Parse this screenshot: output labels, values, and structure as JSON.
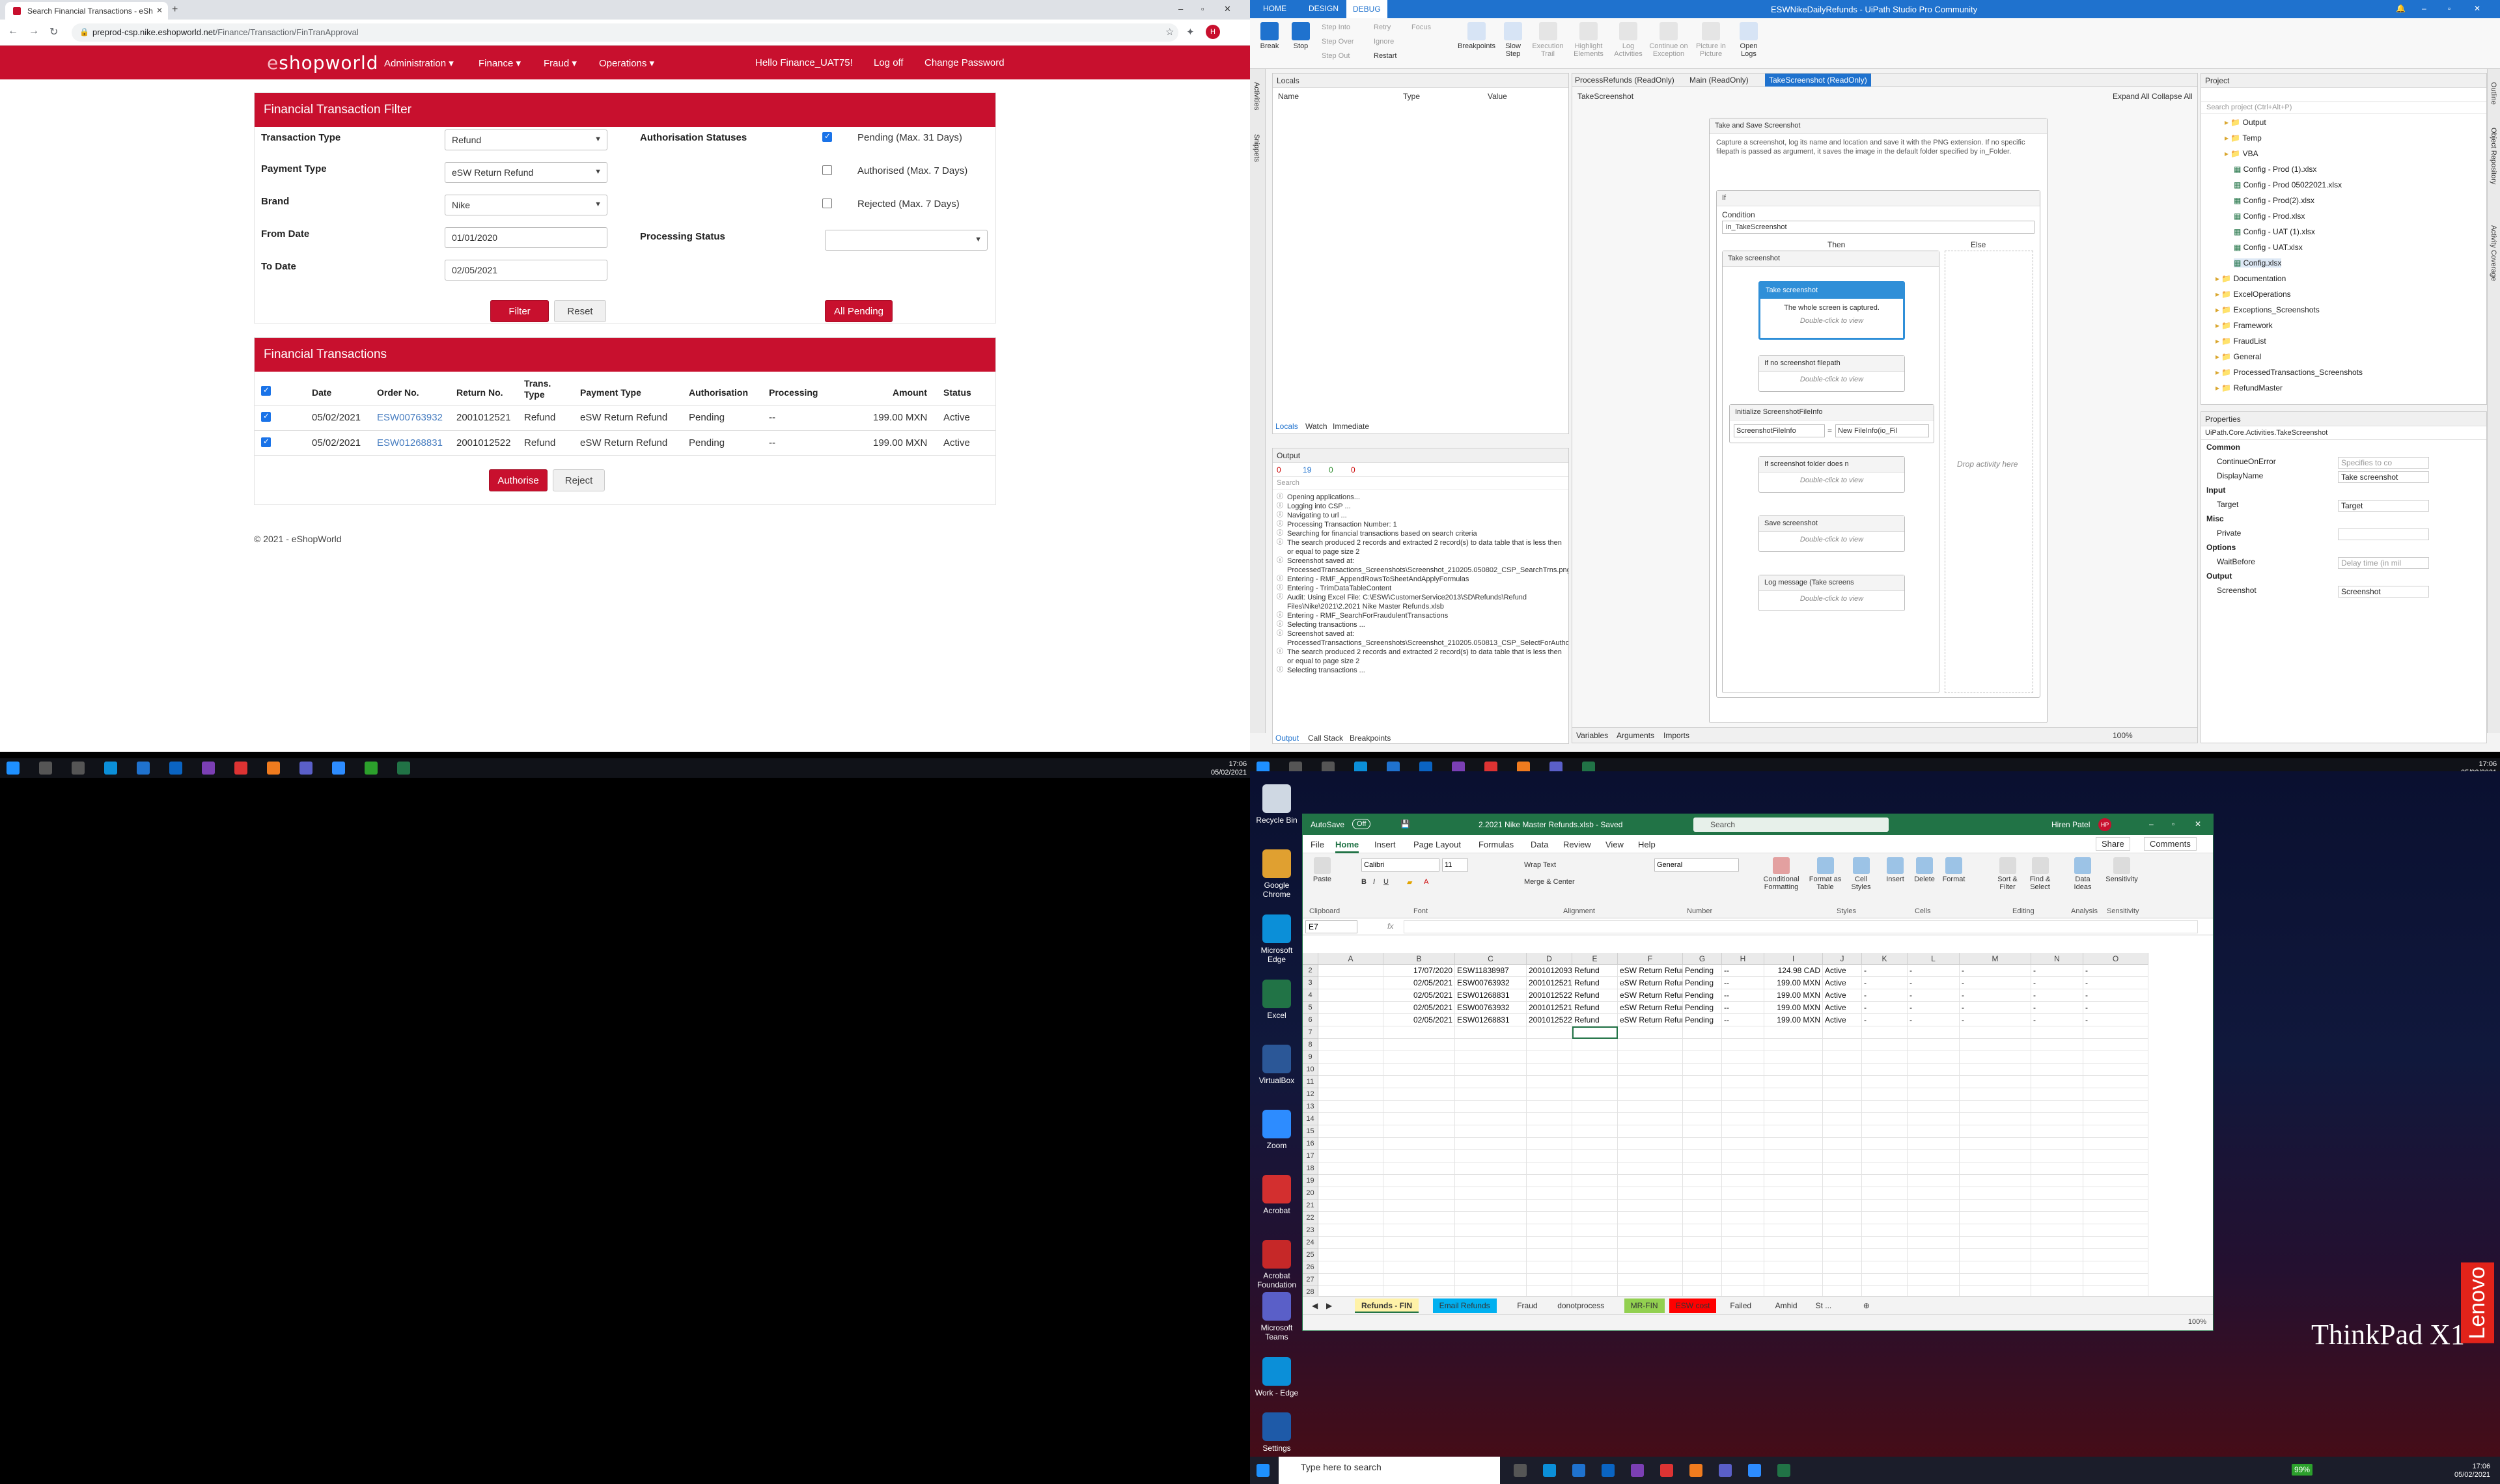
{
  "browser": {
    "tab_title": "Search Financial Transactions - eSh",
    "url_host": "preprod-csp.nike.eshopworld.net",
    "url_path": "/Finance/Transaction/FinTranApproval",
    "avatar_letter": "H",
    "site": {
      "logo_prefix": "e",
      "logo_main": "shopworld",
      "nav": [
        "Administration ▾",
        "Finance ▾",
        "Fraud ▾",
        "Operations ▾"
      ],
      "user_greeting": "Hello Finance_UAT75!",
      "logout": "Log off",
      "change_password": "Change Password",
      "accent": "#c8102e"
    },
    "filter": {
      "title": "Financial Transaction Filter",
      "transaction_type_label": "Transaction Type",
      "transaction_type_value": "Refund",
      "payment_type_label": "Payment Type",
      "payment_type_value": "eSW Return Refund",
      "brand_label": "Brand",
      "brand_value": "Nike",
      "from_date_label": "From Date",
      "from_date_value": "01/01/2020",
      "to_date_label": "To Date",
      "to_date_value": "02/05/2021",
      "auth_statuses_label": "Authorisation Statuses",
      "statuses": [
        {
          "label": "Pending (Max. 31 Days)",
          "checked": true
        },
        {
          "label": "Authorised (Max. 7 Days)",
          "checked": false
        },
        {
          "label": "Rejected (Max. 7 Days)",
          "checked": false
        }
      ],
      "processing_status_label": "Processing Status",
      "processing_status_value": "",
      "filter_button": "Filter",
      "reset_button": "Reset",
      "all_pending_button": "All Pending"
    },
    "transactions": {
      "title": "Financial Transactions",
      "columns": [
        "Date",
        "Order No.",
        "Return No.",
        "Trans. Type",
        "Payment Type",
        "Authorisation",
        "Processing",
        "Amount",
        "Status"
      ],
      "rows": [
        {
          "date": "05/02/2021",
          "order": "ESW00763932",
          "return": "2001012521",
          "type": "Refund",
          "payment": "eSW Return Refund",
          "auth": "Pending",
          "processing": "--",
          "amount": "199.00 MXN",
          "status": "Active"
        },
        {
          "date": "05/02/2021",
          "order": "ESW01268831",
          "return": "2001012522",
          "type": "Refund",
          "payment": "eSW Return Refund",
          "auth": "Pending",
          "processing": "--",
          "amount": "199.00 MXN",
          "status": "Active"
        }
      ],
      "authorise_button": "Authorise",
      "reject_button": "Reject"
    },
    "footer": "© 2021 - eShopWorld"
  },
  "uipath": {
    "title": "ESWNikeDailyRefunds - UiPath Studio Pro Community",
    "tabs": [
      "HOME",
      "DESIGN",
      "DEBUG"
    ],
    "ribbon": [
      "Break",
      "Stop",
      "Step Into",
      "Step Over",
      "Step Out",
      "Retry",
      "Ignore",
      "Restart",
      "Focus",
      "Breakpoints",
      "Slow Step",
      "Execution Trail",
      "Highlight Elements",
      "Log Activities",
      "Continue on Exception",
      "Picture in Picture",
      "Open Logs"
    ],
    "locals": {
      "title": "Locals",
      "cols": [
        "Name",
        "Type",
        "Value"
      ],
      "bottom_tabs": [
        "Locals",
        "Watch",
        "Immediate"
      ]
    },
    "doc_tabs": [
      "ProcessRefunds (ReadOnly)",
      "Main (ReadOnly)",
      "TakeScreenshot (ReadOnly)"
    ],
    "breadcrumb": "TakeScreenshot",
    "expand_all": "Expand All",
    "collapse_all": "Collapse All",
    "workflow": {
      "seq_title": "Take and Save Screenshot",
      "seq_desc": "Capture a screenshot, log its name and location and save it with the PNG extension. If no specific filepath is passed as argument, it saves the image in the default folder specified by in_Folder.",
      "if_title": "If",
      "condition_label": "Condition",
      "condition_value": "in_TakeScreenshot",
      "then": "Then",
      "else": "Else",
      "inner_seq": "Take screenshot",
      "act_take": "Take screenshot",
      "act_take_desc": "The whole screen is captured.",
      "dbl": "Double-click to view",
      "act_if_path": "If no screenshot filepath",
      "act_init": "Initialize ScreenshotFileInfo",
      "init_to": "ScreenshotFileInfo",
      "init_val": "New FileInfo(io_Fil",
      "act_if_folder": "If screenshot folder does n",
      "act_save": "Save screenshot",
      "act_log": "Log message (Take screens",
      "drop_here": "Drop activity here"
    },
    "output": {
      "title": "Output",
      "counts": [
        "0",
        "19",
        "0",
        "0"
      ],
      "search": "Search",
      "lines": [
        "Opening applications...",
        "Logging into CSP ...",
        "Navigating to url ...",
        "Processing Transaction Number: 1",
        "Searching for financial transactions based on search criteria",
        "The search produced 2 records and extracted 2 record(s) to data table that is less then or equal to page size 2",
        "Screenshot saved at: ProcessedTransactions_Screenshots\\Screenshot_210205.050802_CSP_SearchTrns.png",
        "Entering - RMF_AppendRowsToSheetAndApplyFormulas",
        "Entering - TrimDataTableContent",
        "Audit: Using Excel File: C:\\ESW\\CustomerService2013\\SD\\Refunds\\Refund Files\\Nike\\2021\\2.2021 Nike Master Refunds.xlsb",
        "Entering - RMF_SearchForFraudulentTransactions",
        "Selecting transactions ...",
        "Screenshot saved at: ProcessedTransactions_Screenshots\\Screenshot_210205.050813_CSP_SelectForAuthoriseTrns.png",
        "The search produced 2 records and extracted 2 record(s) to data table that is less then or equal to page size 2",
        "Selecting transactions ..."
      ],
      "bottom_tabs": [
        "Output",
        "Call Stack",
        "Breakpoints"
      ]
    },
    "designer_bottom": [
      "Variables",
      "Arguments",
      "Imports"
    ],
    "zoom": "100%",
    "project": {
      "title": "Project",
      "search": "Search project (Ctrl+Alt+P)",
      "items": [
        "Output",
        "Temp",
        "VBA",
        "Config - Prod (1).xlsx",
        "Config - Prod 05022021.xlsx",
        "Config - Prod(2).xlsx",
        "Config - Prod.xlsx",
        "Config - UAT (1).xlsx",
        "Config - UAT.xlsx",
        "Config.xlsx",
        "Documentation",
        "ExcelOperations",
        "Exceptions_Screenshots",
        "Framework",
        "FraudList",
        "General",
        "ProcessedTransactions_Screenshots",
        "RefundMaster"
      ]
    },
    "properties": {
      "title": "Properties",
      "type": "UiPath.Core.Activities.TakeScreenshot",
      "rows": [
        {
          "k": "Common",
          "v": "",
          "section": true
        },
        {
          "k": "ContinueOnError",
          "v": "Specifies to co"
        },
        {
          "k": "DisplayName",
          "v": "Take screenshot"
        },
        {
          "k": "Input",
          "v": "",
          "section": true
        },
        {
          "k": "Target",
          "v": "Target"
        },
        {
          "k": "Misc",
          "v": "",
          "section": true
        },
        {
          "k": "Private",
          "v": ""
        },
        {
          "k": "Options",
          "v": "",
          "section": true
        },
        {
          "k": "WaitBefore",
          "v": "Delay time (in mil"
        },
        {
          "k": "Output",
          "v": "",
          "section": true
        },
        {
          "k": "Screenshot",
          "v": "Screenshot"
        }
      ]
    },
    "side_left": [
      "Activities",
      "Snippets"
    ],
    "side_right": [
      "Outline",
      "Object Repository",
      "Activity Coverage"
    ]
  },
  "taskbar_top_left": {
    "time": "17:06",
    "date": "05/02/2021"
  },
  "taskbar_top_right": {
    "time": "17:06",
    "date": "05/02/2021"
  },
  "desktop": {
    "icons": [
      "Recycle Bin",
      "Google Chrome",
      "Microsoft Edge",
      "Excel",
      "VirtualBox",
      "Zoom",
      "Acrobat",
      "Acrobat Foundation",
      "Microsoft Teams",
      "Work - Edge",
      "Settings"
    ],
    "brand_model": "ThinkPad X1",
    "brand_vendor": "Lenovo"
  },
  "excel": {
    "autosave_label": "AutoSave",
    "autosave_state": "Off",
    "filename": "2.2021 Nike Master Refunds.xlsb - Saved",
    "search": "Search",
    "user": "Hiren Patel",
    "user_initials": "HP",
    "tabs": [
      "File",
      "Home",
      "Insert",
      "Page Layout",
      "Formulas",
      "Data",
      "Review",
      "View",
      "Help"
    ],
    "share": "Share",
    "comments": "Comments",
    "font_name": "Calibri",
    "font_size": "11",
    "wrap_text": "Wrap Text",
    "merge_center": "Merge & Center",
    "number_format": "General",
    "groups": [
      "Clipboard",
      "Font",
      "Alignment",
      "Number",
      "Styles",
      "Cells",
      "Editing",
      "Analysis",
      "Sensitivity"
    ],
    "ribbon_btns": [
      "Paste",
      "Conditional Formatting",
      "Format as Table",
      "Cell Styles",
      "Insert",
      "Delete",
      "Format",
      "Sort & Filter",
      "Find & Select",
      "Data Ideas",
      "Sensitivity"
    ],
    "name_box": "E7",
    "columns": [
      "A",
      "B",
      "C",
      "D",
      "E",
      "F",
      "G",
      "H",
      "I",
      "J",
      "K",
      "L",
      "M",
      "N",
      "O"
    ],
    "rows": [
      [
        "",
        "17/07/2020",
        "ESW11838987",
        "2001012093",
        "Refund",
        "eSW Return Refund",
        "Pending",
        "--",
        "124.98 CAD",
        "Active",
        "-",
        "-",
        "-",
        "-",
        "-"
      ],
      [
        "",
        "02/05/2021",
        "ESW00763932",
        "2001012521",
        "Refund",
        "eSW Return Refund",
        "Pending",
        "--",
        "199.00 MXN",
        "Active",
        "-",
        "-",
        "-",
        "-",
        "-"
      ],
      [
        "",
        "02/05/2021",
        "ESW01268831",
        "2001012522",
        "Refund",
        "eSW Return Refund",
        "Pending",
        "--",
        "199.00 MXN",
        "Active",
        "-",
        "-",
        "-",
        "-",
        "-"
      ],
      [
        "",
        "02/05/2021",
        "ESW00763932",
        "2001012521",
        "Refund",
        "eSW Return Refund",
        "Pending",
        "--",
        "199.00 MXN",
        "Active",
        "-",
        "-",
        "-",
        "-",
        "-"
      ],
      [
        "",
        "02/05/2021",
        "ESW01268831",
        "2001012522",
        "Refund",
        "eSW Return Refund",
        "Pending",
        "--",
        "199.00 MXN",
        "Active",
        "-",
        "-",
        "-",
        "-",
        "-"
      ]
    ],
    "sheets": [
      {
        "name": "Refunds - FIN",
        "color": "#fff2a8"
      },
      {
        "name": "Email Refunds",
        "color": "#00b0f0"
      },
      {
        "name": "Fraud",
        "color": ""
      },
      {
        "name": "donotprocess",
        "color": ""
      },
      {
        "name": "MR-FIN",
        "color": "#92d050"
      },
      {
        "name": "ESW cost",
        "color": "#ff0000"
      },
      {
        "name": "Failed",
        "color": ""
      },
      {
        "name": "Amhid",
        "color": ""
      },
      {
        "name": "St ...",
        "color": ""
      }
    ],
    "zoom": "100%"
  },
  "taskbar_bottom": {
    "search": "Type here to search",
    "battery": "99%",
    "time": "17:06",
    "date": "05/02/2021"
  }
}
